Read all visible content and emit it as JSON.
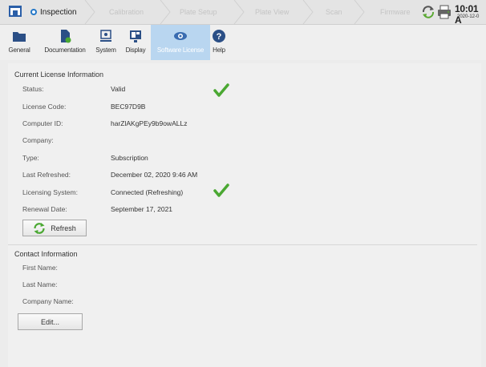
{
  "topbar": {
    "tabs": [
      {
        "label": "Inspection"
      },
      {
        "label": "Calibration"
      },
      {
        "label": "Plate Setup"
      },
      {
        "label": "Plate View"
      },
      {
        "label": "Scan"
      },
      {
        "label": "Firmware"
      }
    ],
    "clock": "10:01 A",
    "date": "2020-12-0"
  },
  "toolbar": {
    "items": [
      {
        "label": "General",
        "icon": "folder-icon"
      },
      {
        "label": "Documentation",
        "icon": "document-icon"
      },
      {
        "label": "System",
        "icon": "computer-icon"
      },
      {
        "label": "Display",
        "icon": "display-icon"
      },
      {
        "label": "Software License",
        "icon": "eye-icon"
      },
      {
        "label": "Help",
        "icon": "help-icon"
      }
    ]
  },
  "license": {
    "section_title": "Current License Information",
    "fields": [
      {
        "label": "Status:",
        "value": "Valid"
      },
      {
        "label": "License Code:",
        "value": "BEC97D9B"
      },
      {
        "label": "Computer ID:",
        "value": "harZlAKgPEy9b9owALLz"
      },
      {
        "label": "Company:",
        "value": ""
      },
      {
        "label": "Type:",
        "value": "Subscription"
      },
      {
        "label": "Last Refreshed:",
        "value": "December 02, 2020 9:46 AM"
      },
      {
        "label": "Licensing System:",
        "value": "Connected (Refreshing)"
      },
      {
        "label": "Renewal Date:",
        "value": "September 17, 2021"
      }
    ],
    "refresh_label": "Refresh"
  },
  "contact": {
    "section_title": "Contact Information",
    "fields": [
      {
        "label": "First Name:"
      },
      {
        "label": "Last Name:"
      },
      {
        "label": "Company Name:"
      }
    ],
    "edit_label": "Edit..."
  },
  "colors": {
    "accent": "#2478c8",
    "check": "#4aa832",
    "selected_tool": "#b9d6f0"
  }
}
